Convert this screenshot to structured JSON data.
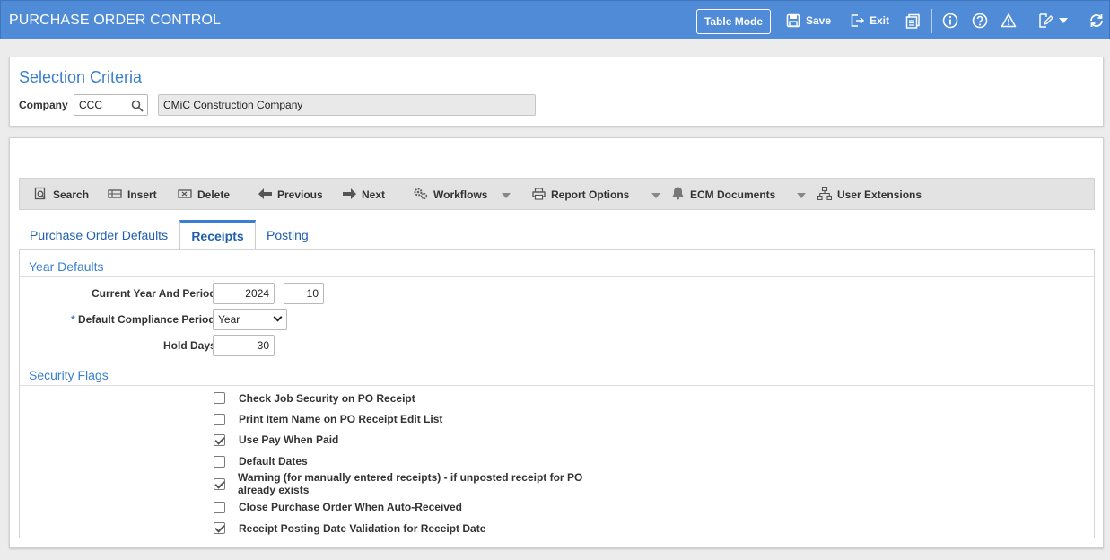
{
  "header": {
    "title": "PURCHASE ORDER CONTROL",
    "table_mode_label": "Table Mode",
    "save_label": "Save",
    "exit_label": "Exit"
  },
  "selection": {
    "title": "Selection Criteria",
    "company_label": "Company",
    "company_value": "CCC",
    "company_name": "CMiC Construction Company"
  },
  "toolbar": {
    "search": "Search",
    "insert": "Insert",
    "delete": "Delete",
    "previous": "Previous",
    "next": "Next",
    "workflows": "Workflows",
    "report_options": "Report Options",
    "ecm_documents": "ECM Documents",
    "user_extensions": "User Extensions"
  },
  "tabs": [
    {
      "label": "Purchase Order Defaults",
      "active": false
    },
    {
      "label": "Receipts",
      "active": true
    },
    {
      "label": "Posting",
      "active": false
    }
  ],
  "year_defaults": {
    "title": "Year Defaults",
    "current_year_label": "Current Year And Period",
    "year_value": "2024",
    "period_value": "10",
    "required_marker": "*",
    "compliance_label": "Default Compliance Period",
    "compliance_value": "Year",
    "hold_days_label": "Hold Days",
    "hold_days_value": "30"
  },
  "security_flags": {
    "title": "Security Flags",
    "items": [
      {
        "label": "Check Job Security on PO Receipt",
        "checked": false
      },
      {
        "label": "Print Item Name on PO Receipt Edit List",
        "checked": false
      },
      {
        "label": "Use Pay When Paid",
        "checked": true
      },
      {
        "label": "Default Dates",
        "checked": false
      },
      {
        "label": "Warning (for manually entered receipts) - if unposted receipt for PO already exists",
        "checked": true
      },
      {
        "label": "Close Purchase Order When Auto-Received",
        "checked": false
      },
      {
        "label": "Receipt Posting Date Validation for Receipt Date",
        "checked": true
      }
    ]
  },
  "colors": {
    "header_bg": "#4f8bd6",
    "accent": "#3a7fcf",
    "tab_text": "#1f5fae"
  }
}
